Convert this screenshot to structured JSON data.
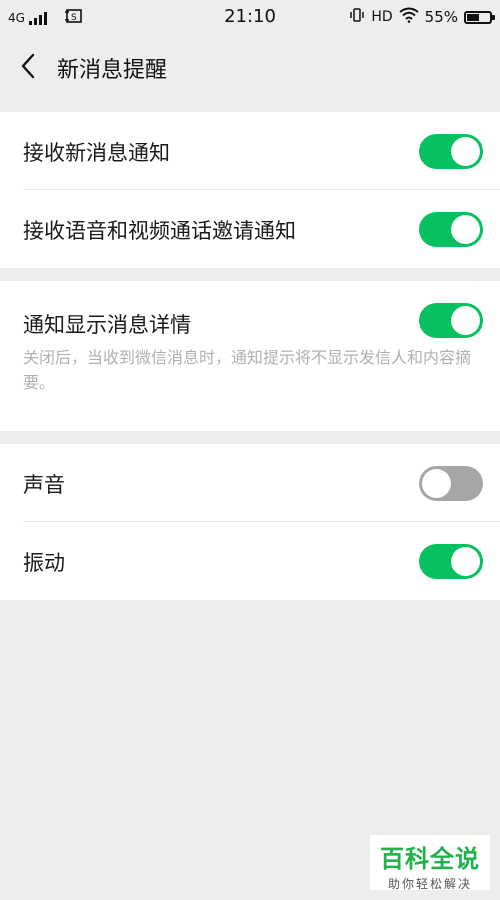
{
  "statusbar": {
    "network": "4G",
    "time": "21:10",
    "hd": "HD",
    "battery_text": "55%",
    "battery_level": 0.55
  },
  "navbar": {
    "title": "新消息提醒"
  },
  "groups": [
    {
      "rows": [
        {
          "label": "接收新消息通知",
          "on": true
        },
        {
          "label": "接收语音和视频通话邀请通知",
          "on": true
        }
      ]
    },
    {
      "rows": [
        {
          "label": "通知显示消息详情",
          "on": true
        }
      ],
      "description": "关闭后，当收到微信消息时，通知提示将不显示发信人和内容摘要。"
    },
    {
      "rows": [
        {
          "label": "声音",
          "on": false
        },
        {
          "label": "振动",
          "on": true
        }
      ]
    }
  ],
  "watermark": {
    "title": "百科全说",
    "subtitle": "助你轻松解决"
  },
  "colors": {
    "toggle_on": "#07c160",
    "toggle_off": "#a6a6a6",
    "watermark_green": "#1fb14a"
  }
}
